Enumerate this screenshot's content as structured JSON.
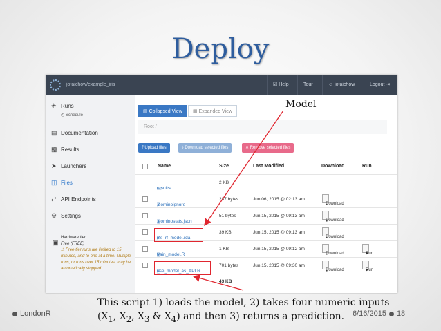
{
  "slide": {
    "title": "Deploy"
  },
  "topbar": {
    "project": "jofaichow/example_iris",
    "help": "Help",
    "tour": "Tour",
    "user": "jofaichow",
    "logout": "Logout"
  },
  "sidebar": {
    "runs": "Runs",
    "schedule": "Schedule",
    "documentation": "Documentation",
    "results": "Results",
    "launchers": "Launchers",
    "files": "Files",
    "api_endpoints": "API Endpoints",
    "settings": "Settings",
    "hardware_tier": "Hardware tier",
    "tier_value": "Free (FREE)",
    "tier_warning": "Free-tier runs are limited to 15 minutes, and to one at a time. Multiple runs, or runs over 15 minutes, may be automatically stopped."
  },
  "main": {
    "tab_collapsed": "Collapsed View",
    "tab_expanded": "Expanded View",
    "breadcrumb": "Root /",
    "upload": "Upload files",
    "download_selected": "Download selected files",
    "remove_selected": "Remove selected files",
    "columns": {
      "name": "Name",
      "size": "Size",
      "modified": "Last Modified",
      "download": "Download",
      "run": "Run"
    },
    "rows": [
      {
        "name": "results/",
        "size": "2 KB",
        "modified": "",
        "download": "",
        "run": ""
      },
      {
        "name": ".dominoignore",
        "size": "287 bytes",
        "modified": "Jun 06, 2015 @ 02:13 am",
        "download": "Download",
        "run": ""
      },
      {
        "name": ".dominostats.json",
        "size": "51 bytes",
        "modified": "Jun 15, 2015 @ 09:13 am",
        "download": "Download",
        "run": ""
      },
      {
        "name": "iris_rf_model.rda",
        "size": "39 KB",
        "modified": "Jun 15, 2015 @ 09:13 am",
        "download": "Download",
        "run": ""
      },
      {
        "name": "train_model.R",
        "size": "1 KB",
        "modified": "Jun 15, 2015 @ 09:12 am",
        "download": "Download",
        "run": "Run"
      },
      {
        "name": "use_model_as_API.R",
        "size": "701 bytes",
        "modified": "Jun 15, 2015 @ 09:30 am",
        "download": "Download",
        "run": "Run"
      }
    ],
    "total": "43 KB"
  },
  "callouts": {
    "model": "Model",
    "script_line1": "This script 1) loads the model, 2) takes four numeric inputs",
    "script_line2_prefix": "(X",
    "script_line2_rest": "& X",
    "script_line2_end": ") and then 3) returns a prediction."
  },
  "footer": {
    "left": "LondonR",
    "date": "6/16/2015",
    "page": "18"
  },
  "colors": {
    "title": "#2e5d9e",
    "accent": "#3a78c4",
    "highlight": "#e0262f",
    "remove": "#e86a8a",
    "download_btn": "#8fb0d8"
  }
}
